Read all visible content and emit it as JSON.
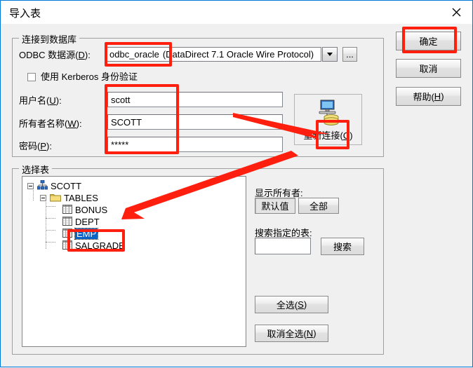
{
  "window": {
    "title": "导入表",
    "close_icon": "close-icon"
  },
  "connect_group": {
    "title": "连接到数据库",
    "odbc_label": "ODBC 数据源(D):",
    "odbc_value": "odbc_oracle",
    "odbc_driver": "(DataDirect 7.1 Oracle Wire Protocol)",
    "ellipsis_label": "...",
    "kerberos_label": "使用 Kerberos 身份验证",
    "kerberos_checked": false,
    "username_label": "用户名(U):",
    "username_value": "scott",
    "owner_label": "所有者名称(W):",
    "owner_value": "SCOTT",
    "password_label": "密码(P):",
    "password_value": "*****",
    "reconnect_label": "重新连接(C)",
    "reconnect_icon": "computer-database-icon"
  },
  "select_group": {
    "title": "选择表",
    "tree": [
      {
        "label": "SCOTT",
        "icon": "sitemap-icon",
        "level": 0,
        "expanded": true,
        "selected": false
      },
      {
        "label": "TABLES",
        "icon": "folder-icon",
        "level": 1,
        "expanded": true,
        "selected": false
      },
      {
        "label": "BONUS",
        "icon": "table-icon",
        "level": 2,
        "expanded": false,
        "selected": false
      },
      {
        "label": "DEPT",
        "icon": "table-icon",
        "level": 2,
        "expanded": false,
        "selected": false
      },
      {
        "label": "EMP",
        "icon": "table-icon",
        "level": 2,
        "expanded": false,
        "selected": true
      },
      {
        "label": "SALGRADE",
        "icon": "table-icon",
        "level": 2,
        "expanded": false,
        "selected": false
      }
    ],
    "show_owner_label": "显示所有者:",
    "owner_default_btn": "默认值",
    "owner_all_btn": "全部",
    "search_table_label": "搜索指定的表:",
    "search_input_value": "",
    "search_btn": "搜索",
    "select_all_btn": "全选(S)",
    "deselect_all_btn": "取消全选(N)"
  },
  "actions": {
    "ok": "确定",
    "cancel": "取消",
    "help": "帮助(H)"
  },
  "colors": {
    "annotation": "#ff1f0f",
    "selection": "#0a64c8",
    "title_border": "#0078d7"
  }
}
